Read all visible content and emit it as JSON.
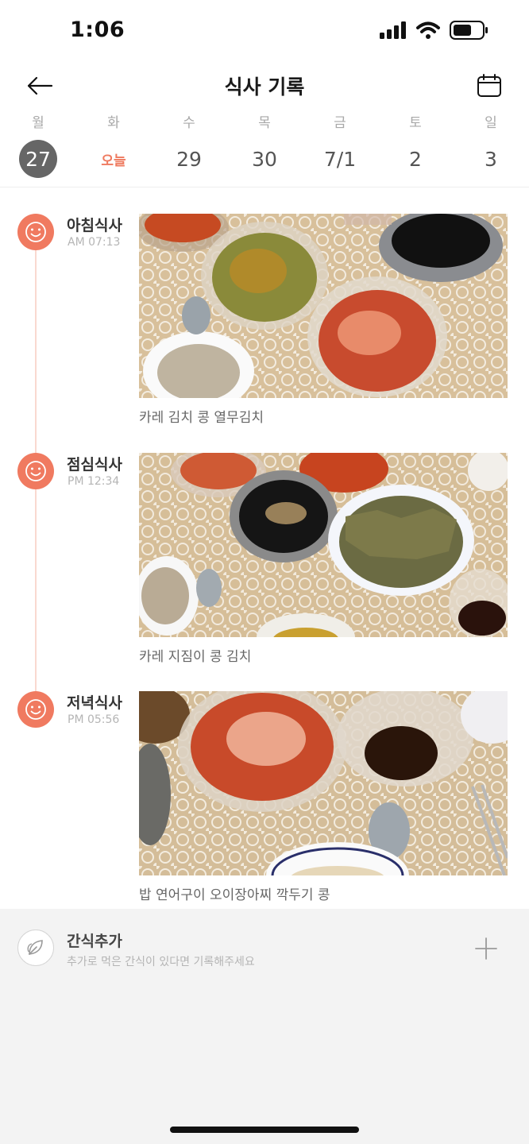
{
  "status_bar": {
    "time": "1:06"
  },
  "header": {
    "title": "식사 기록"
  },
  "week": [
    {
      "label": "월",
      "value": "27",
      "state": "selected"
    },
    {
      "label": "화",
      "value": "오늘",
      "state": "today"
    },
    {
      "label": "수",
      "value": "29",
      "state": "normal"
    },
    {
      "label": "목",
      "value": "30",
      "state": "normal"
    },
    {
      "label": "금",
      "value": "7/1",
      "state": "normal"
    },
    {
      "label": "토",
      "value": "2",
      "state": "normal"
    },
    {
      "label": "일",
      "value": "3",
      "state": "normal"
    }
  ],
  "meals": [
    {
      "name": "아침식사",
      "time": "AM 07:13",
      "description": "카레 김치 콩 열무김치"
    },
    {
      "name": "점심식사",
      "time": "PM 12:34",
      "description": "카레 지짐이 콩 김치"
    },
    {
      "name": "저녁식사",
      "time": "PM 05:56",
      "description": "밥 연어구이 오이장아찌 깍두기 콩"
    }
  ],
  "snack": {
    "title": "간식추가",
    "subtitle": "추가로 먹은 간식이 있다면 기록해주세요"
  },
  "colors": {
    "accent": "#f07a60",
    "today": "#ef7a5f",
    "selected_day": "#666666",
    "snack_bg": "#f3f3f3"
  },
  "icons": {
    "meal": "smile-icon",
    "snack": "leaf-icon",
    "add": "plus-icon",
    "back": "arrow-left-icon",
    "calendar": "calendar-icon"
  }
}
